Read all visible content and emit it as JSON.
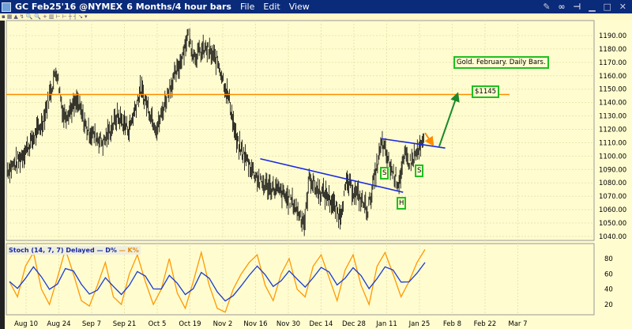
{
  "window": {
    "symbol": "GC Feb25'16 @NYMEX",
    "period": "6 Months/4 hour bars",
    "menu": [
      "File",
      "Edit",
      "View"
    ],
    "controls": "✎ ∞ ⊣ ▁ □ ✕"
  },
  "toolbar": "▪▦▲↯🔍🔍+▥⊢⊢┼┤↘▾",
  "stoch_legend": {
    "name": "Stoch",
    "params": "(14, 7, 7) Delayed",
    "d": "— D%",
    "k": "— K%"
  },
  "annotations": {
    "title": "Gold. February. Daily Bars.",
    "target": "$1145",
    "s1": "S",
    "h": "H",
    "s2": "S"
  },
  "colors": {
    "bg": "#fffcd0",
    "price": "#000000",
    "resistance": "#ff8c00",
    "trend": "#1a2ae0",
    "arrow": "#1a8a2a",
    "k": "#ff9900",
    "d": "#1a3ad0"
  },
  "chart_data": {
    "type": "line",
    "x_unit": "days since Aug 10",
    "x_ticks": [
      "Aug 10",
      "Aug 24",
      "Sep 7",
      "Sep 21",
      "Oct 5",
      "Oct 19",
      "Nov 2",
      "Nov 16",
      "Nov 30",
      "Dec 14",
      "Dec 28",
      "Jan 11",
      "Jan 25",
      "Feb 8",
      "Feb 22",
      "Mar 7"
    ],
    "y_ticks": [
      1190,
      1180,
      1170,
      1160,
      1150,
      1140,
      1130,
      1120,
      1110,
      1100,
      1090,
      1080,
      1070,
      1060,
      1050,
      1040
    ],
    "ylim": [
      1036,
      1198
    ],
    "price": [
      [
        -8,
        1090
      ],
      [
        -4,
        1095
      ],
      [
        2,
        1110
      ],
      [
        7,
        1125
      ],
      [
        13,
        1165
      ],
      [
        16,
        1130
      ],
      [
        22,
        1140
      ],
      [
        26,
        1120
      ],
      [
        33,
        1110
      ],
      [
        39,
        1130
      ],
      [
        44,
        1120
      ],
      [
        49,
        1150
      ],
      [
        56,
        1120
      ],
      [
        61,
        1150
      ],
      [
        65,
        1165
      ],
      [
        69,
        1190
      ],
      [
        72,
        1175
      ],
      [
        77,
        1180
      ],
      [
        82,
        1170
      ],
      [
        87,
        1140
      ],
      [
        90,
        1110
      ],
      [
        95,
        1095
      ],
      [
        100,
        1080
      ],
      [
        107,
        1075
      ],
      [
        114,
        1065
      ],
      [
        119,
        1050
      ],
      [
        121,
        1085
      ],
      [
        124,
        1075
      ],
      [
        129,
        1070
      ],
      [
        134,
        1055
      ],
      [
        137,
        1080
      ],
      [
        142,
        1070
      ],
      [
        146,
        1060
      ],
      [
        149,
        1085
      ],
      [
        152,
        1110
      ],
      [
        156,
        1090
      ],
      [
        159,
        1080
      ],
      [
        162,
        1100
      ],
      [
        164,
        1095
      ],
      [
        168,
        1105
      ],
      [
        170,
        1110
      ]
    ],
    "resistance": 1146,
    "trendlines": [
      {
        "from": [
          100,
          1098
        ],
        "to": [
          161,
          1073
        ]
      },
      {
        "from": [
          152,
          1113
        ],
        "to": [
          179,
          1106
        ]
      }
    ],
    "stoch": {
      "ylim": [
        0,
        100
      ],
      "y_ticks": [
        80,
        60,
        40,
        20
      ],
      "k": [
        50,
        30,
        70,
        88,
        40,
        20,
        55,
        92,
        60,
        25,
        18,
        45,
        75,
        30,
        20,
        60,
        85,
        50,
        20,
        40,
        80,
        35,
        15,
        50,
        88,
        45,
        15,
        10,
        40,
        60,
        75,
        85,
        45,
        25,
        60,
        80,
        40,
        30,
        70,
        85,
        55,
        25,
        65,
        85,
        45,
        20,
        70,
        88,
        60,
        30,
        50,
        75,
        92
      ]
    }
  }
}
